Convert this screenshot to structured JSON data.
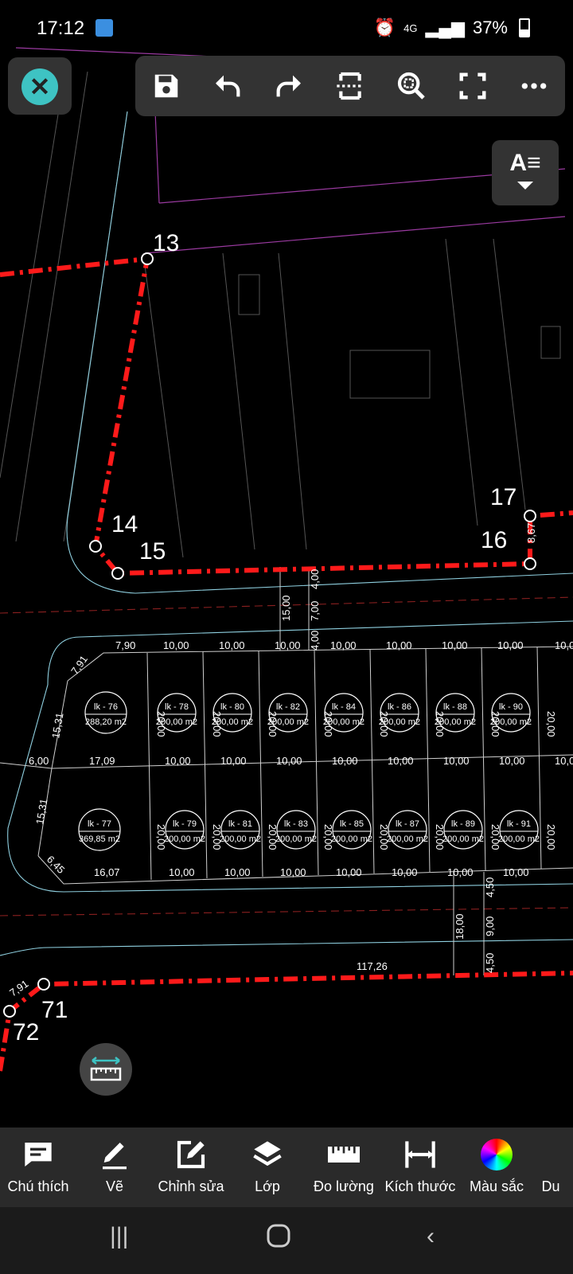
{
  "status": {
    "time": "17:12",
    "network": "4G",
    "battery": "37%"
  },
  "toolbar": {
    "icons": [
      "save-icon",
      "undo-icon",
      "redo-icon",
      "section-icon",
      "zoom-extent-icon",
      "fullscreen-icon",
      "more-icon"
    ]
  },
  "text_button": {
    "label": "A≡"
  },
  "drawing": {
    "points": [
      "13",
      "14",
      "15",
      "16",
      "17",
      "71",
      "72"
    ],
    "segment_labels": [
      "8,67",
      "7,91",
      "117,26",
      "4,00",
      "7,00",
      "15,00",
      "4,00",
      "18,00",
      "9,00",
      "4,50",
      "4,50"
    ],
    "top_row_widths": [
      "7,90",
      "10,00",
      "10,00",
      "10,00",
      "10,00",
      "10,00",
      "10,00",
      "10,00",
      "10,0"
    ],
    "mid_row_widths": [
      "6,00",
      "17,09",
      "10,00",
      "10,00",
      "10,00",
      "10,00",
      "10,00",
      "10,00",
      "10,00",
      "10,0"
    ],
    "bot_row_widths": [
      "16,07",
      "10,00",
      "10,00",
      "10,00",
      "10,00",
      "10,00",
      "10,00",
      "10,00"
    ],
    "side_labels": [
      "7,91",
      "15,31",
      "15,31",
      "6,45"
    ],
    "depth_label": "20,00",
    "lots_top": [
      {
        "id": "lk - 76",
        "area": "288,20 m2"
      },
      {
        "id": "lk - 78",
        "area": "200,00 m2"
      },
      {
        "id": "lk - 80",
        "area": "200,00 m2"
      },
      {
        "id": "lk - 82",
        "area": "200,00 m2"
      },
      {
        "id": "lk - 84",
        "area": "200,00 m2"
      },
      {
        "id": "lk - 86",
        "area": "200,00 m2"
      },
      {
        "id": "lk - 88",
        "area": "200,00 m2"
      },
      {
        "id": "lk - 90",
        "area": "200,00 m2"
      }
    ],
    "lots_bottom": [
      {
        "id": "lk - 77",
        "area": "369,85 m2"
      },
      {
        "id": "lk - 79",
        "area": "200,00 m2"
      },
      {
        "id": "lk - 81",
        "area": "200,00 m2"
      },
      {
        "id": "lk - 83",
        "area": "200,00 m2"
      },
      {
        "id": "lk - 85",
        "area": "200,00 m2"
      },
      {
        "id": "lk - 87",
        "area": "200,00 m2"
      },
      {
        "id": "lk - 89",
        "area": "200,00 m2"
      },
      {
        "id": "lk - 91",
        "area": "200,00 m2"
      }
    ]
  },
  "bottom_bar": {
    "items": [
      {
        "label": "Chú thích",
        "icon": "comment-icon"
      },
      {
        "label": "Vẽ",
        "icon": "pencil-icon"
      },
      {
        "label": "Chỉnh sửa",
        "icon": "edit-icon"
      },
      {
        "label": "Lớp",
        "icon": "layers-icon"
      },
      {
        "label": "Đo lường",
        "icon": "ruler-icon"
      },
      {
        "label": "Kích thước",
        "icon": "dimension-icon"
      },
      {
        "label": "Màu sắc",
        "icon": "color-wheel-icon"
      },
      {
        "label": "Du",
        "icon": "more-tools-icon"
      }
    ]
  },
  "colors": {
    "boundary": "#ff1a1a",
    "accent": "#3ec3c3",
    "panel": "#333333"
  }
}
